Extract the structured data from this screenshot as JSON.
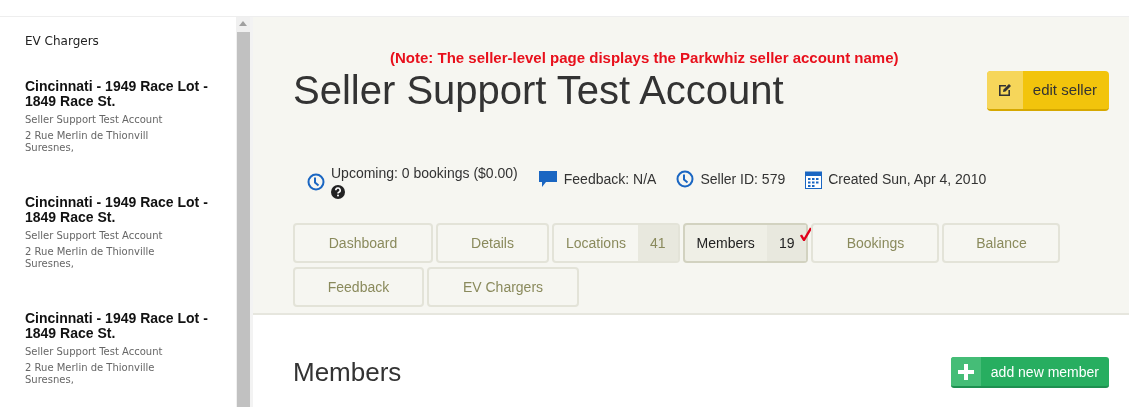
{
  "sidebar": {
    "heading": "EV Chargers",
    "items": [
      {
        "title": "Cincinnati - 1949 Race Lot - 1849 Race St.",
        "seller": "Seller Support Test Account",
        "address": "2 Rue Merlin de Thionvill",
        "city": "Suresnes,"
      },
      {
        "title": "Cincinnati - 1949 Race Lot - 1849 Race St.",
        "seller": "Seller Support Test Account",
        "address": "2 Rue Merlin de Thionville",
        "city": "Suresnes,"
      },
      {
        "title": "Cincinnati - 1949 Race Lot - 1849 Race St.",
        "seller": "Seller Support Test Account",
        "address": "2 Rue Merlin de Thionville",
        "city": "Suresnes,"
      }
    ]
  },
  "note": "(Note: The seller-level page displays the Parkwhiz seller account name)",
  "title": "Seller Support Test Account",
  "edit_button": "edit seller",
  "stats": [
    {
      "kind": "clock",
      "text": "Upcoming: 0 bookings ($0.00)",
      "help": true
    },
    {
      "kind": "chat",
      "text": "Feedback: N/A",
      "help": false
    },
    {
      "kind": "clock",
      "text": "Seller ID: 579",
      "help": false
    },
    {
      "kind": "calendar",
      "text": "Created Sun, Apr 4, 2010",
      "help": false
    }
  ],
  "tabs": [
    {
      "label": "Dashboard",
      "selected": false
    },
    {
      "label": "Details",
      "selected": false
    },
    {
      "label": "Locations",
      "count": "41",
      "selected": false
    },
    {
      "label": "Members",
      "count": "19",
      "selected": true,
      "annotated": true
    },
    {
      "label": "Bookings",
      "selected": false
    },
    {
      "label": "Balance",
      "selected": false
    },
    {
      "label": "Feedback",
      "selected": false
    },
    {
      "label": "EV Chargers",
      "selected": false
    }
  ],
  "section": {
    "heading": "Members",
    "button": "add new member"
  }
}
